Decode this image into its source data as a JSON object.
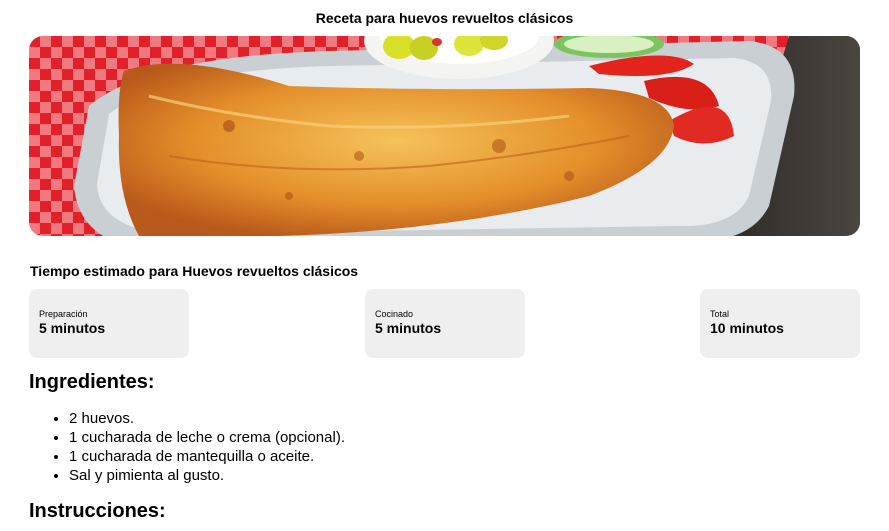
{
  "page": {
    "title": "Receta para huevos revueltos clásicos"
  },
  "hero_image": {
    "icon": "omelette-photo"
  },
  "time": {
    "heading": "Tiempo estimado para Huevos revueltos clásicos",
    "cards": [
      {
        "label": "Preparación",
        "value": "5 minutos"
      },
      {
        "label": "Cocinado",
        "value": "5 minutos"
      },
      {
        "label": "Total",
        "value": "10 minutos"
      }
    ]
  },
  "ingredients": {
    "heading": "Ingredientes:",
    "items": [
      "2 huevos.",
      "1 cucharada de leche o crema (opcional).",
      "1 cucharada de mantequilla o aceite.",
      "Sal y pimienta al gusto."
    ]
  },
  "instructions": {
    "heading": "Instrucciones:"
  },
  "colors": {
    "card_bg": "#efefef",
    "tablecloth_red": "#e2202a",
    "omelette": "#e0892c"
  }
}
